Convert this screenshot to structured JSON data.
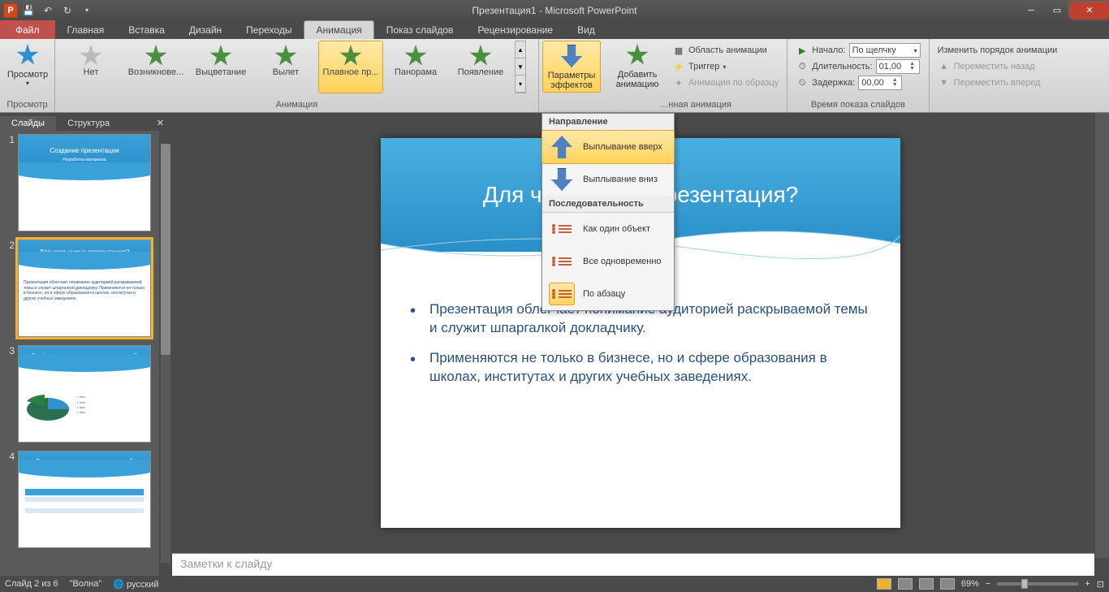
{
  "title": "Презентация1 - Microsoft PowerPoint",
  "qat": {
    "logo": "P"
  },
  "tabs": {
    "file": "Файл",
    "items": [
      "Главная",
      "Вставка",
      "Дизайн",
      "Переходы",
      "Анимация",
      "Показ слайдов",
      "Рецензирование",
      "Вид"
    ],
    "active": "Анимация"
  },
  "ribbon": {
    "preview": {
      "label": "Просмотр",
      "group": "Просмотр"
    },
    "animations": {
      "items": [
        "Нет",
        "Возникнове...",
        "Выцветание",
        "Вылет",
        "Плавное пр...",
        "Панорама",
        "Появление"
      ],
      "selected": "Плавное пр...",
      "group": "Анимация"
    },
    "effect_options": "Параметры эффектов",
    "add_animation": "Добавить анимацию",
    "advanced": {
      "pane": "Область анимации",
      "trigger": "Триггер",
      "painter": "Анимация по образцу",
      "group": "…нная анимация"
    },
    "timing": {
      "start_label": "Начало:",
      "start_value": "По щелчку",
      "duration_label": "Длительность:",
      "duration_value": "01,00",
      "delay_label": "Задержка:",
      "delay_value": "00,00",
      "group": "Время показа слайдов"
    },
    "reorder": {
      "title": "Изменить порядок анимации",
      "back": "Переместить назад",
      "fwd": "Переместить вперед"
    }
  },
  "dropdown": {
    "section1": "Направление",
    "up": "Выплывание вверх",
    "down": "Выплывание вниз",
    "section2": "Последовательность",
    "one": "Как один объект",
    "all": "Все одновременно",
    "para": "По абзацу"
  },
  "side": {
    "tab_slides": "Слайды",
    "tab_outline": "Структура",
    "slides": [
      {
        "n": "1",
        "title": "Создание презентации",
        "sub": "Разработка материала"
      },
      {
        "n": "2",
        "title": "Для чего нужна презентация?",
        "body": "Презентация облегчает понимание аудиторией раскрываемой темы и служит шпаргалкой докладчику. Применяются не только в бизнесе, но и сфере образования в школах, институтах и других учебных заведениях."
      },
      {
        "n": "3",
        "title": "График популярности презентаций",
        "body": ""
      },
      {
        "n": "4",
        "title": "Рост популярности презентаций",
        "body": ""
      }
    ]
  },
  "slide": {
    "title": "Для чего нужна презентация?",
    "bullet1": "Презентация облегчает понимание аудиторией раскрываемой темы и служит шпаргалкой докладчику.",
    "bullet2": "Применяются не только в бизнесе, но и сфере образования в школах, институтах и других учебных заведениях."
  },
  "notes_placeholder": "Заметки к слайду",
  "status": {
    "slide": "Слайд 2 из 6",
    "theme": "\"Волна\"",
    "lang": "русский",
    "zoom": "69%"
  }
}
